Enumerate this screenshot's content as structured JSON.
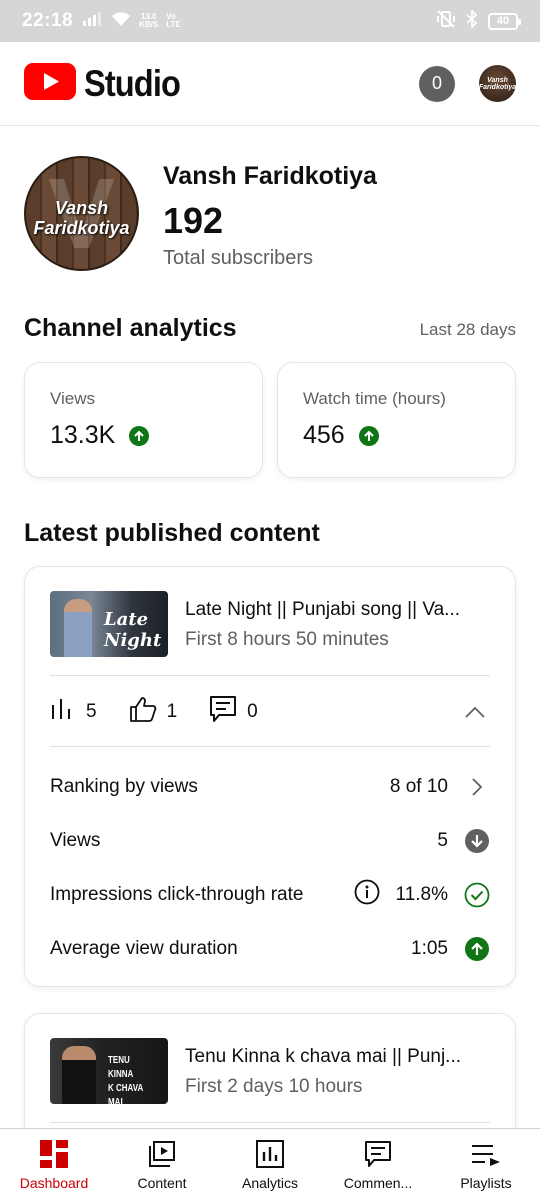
{
  "status_bar": {
    "time": "22:18",
    "net_speed_top": "13.0",
    "net_speed_bottom": "KB/S",
    "net_top": "Vo",
    "net_bottom": "LTE",
    "battery": "40"
  },
  "header": {
    "app_name": "Studio",
    "notification_count": "0",
    "avatar_text": "Vansh Faridkotiya"
  },
  "channel": {
    "avatar_line1": "Vansh",
    "avatar_line2": "Faridkotiya",
    "name": "Vansh Faridkotiya",
    "subscribers": "192",
    "subscribers_label": "Total subscribers"
  },
  "analytics": {
    "title": "Channel analytics",
    "period": "Last 28 days",
    "metrics": [
      {
        "label": "Views",
        "value": "13.3K",
        "trend": "up"
      },
      {
        "label": "Watch time (hours)",
        "value": "456",
        "trend": "up"
      }
    ]
  },
  "latest": {
    "title": "Latest published content",
    "videos": [
      {
        "thumb_text": "Late Night",
        "title": "Late Night || Punjabi song || Va...",
        "age": "First 8 hours 50 minutes",
        "views": "5",
        "likes": "1",
        "comments": "0",
        "details": [
          {
            "label": "Ranking by views",
            "value": "8 of 10",
            "icon": "chevron-right-icon"
          },
          {
            "label": "Views",
            "value": "5",
            "icon": "down-arrow-icon"
          },
          {
            "label": "Impressions click-through rate",
            "value": "11.8%",
            "icon": "check-circle-icon"
          },
          {
            "label": "Average view duration",
            "value": "1:05",
            "icon": "up-arrow-icon"
          }
        ]
      },
      {
        "thumb_line1": "TENU KINNA",
        "thumb_line2": "K CHAVA MAI",
        "title": "Tenu Kinna k chava mai || Punj...",
        "age": "First 2 days 10 hours"
      }
    ]
  },
  "bottom_nav": [
    {
      "label": "Dashboard",
      "icon": "dashboard-icon",
      "active": true
    },
    {
      "label": "Content",
      "icon": "content-icon"
    },
    {
      "label": "Analytics",
      "icon": "analytics-icon"
    },
    {
      "label": "Commen...",
      "icon": "comments-icon"
    },
    {
      "label": "Playlists",
      "icon": "playlists-icon"
    }
  ],
  "colors": {
    "brand_red": "#ff0000",
    "trend_up": "#107516",
    "trend_neutral": "#606060",
    "nav_active": "#cc0000"
  }
}
